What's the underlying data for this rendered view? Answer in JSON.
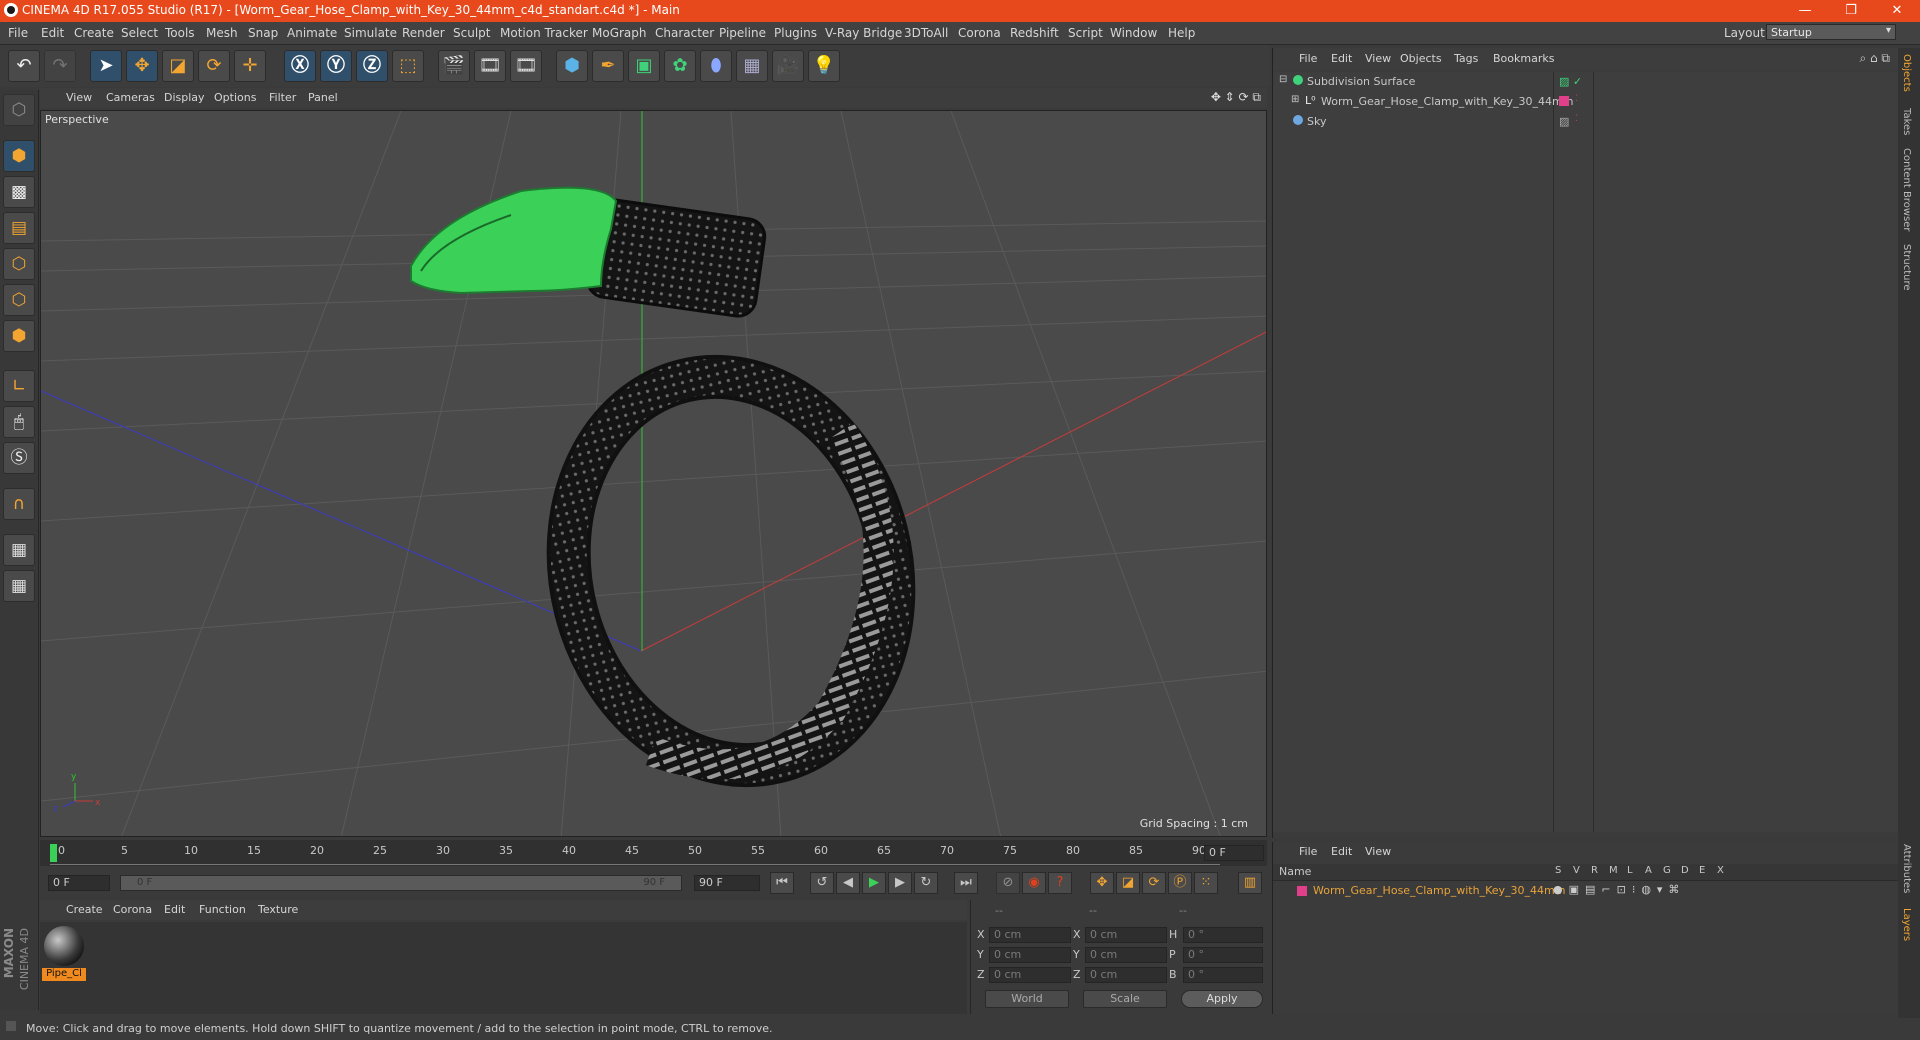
{
  "window": {
    "title": "CINEMA 4D R17.055 Studio (R17) - [Worm_Gear_Hose_Clamp_with_Key_30_44mm_c4d_standart.c4d *] - Main",
    "minimize": "—",
    "maximize": "❐",
    "close": "✕"
  },
  "menubar": [
    "File",
    "Edit",
    "Create",
    "Select",
    "Tools",
    "Mesh",
    "Snap",
    "Animate",
    "Simulate",
    "Render",
    "Sculpt",
    "Motion Tracker",
    "MoGraph",
    "Character",
    "Pipeline",
    "Plugins",
    "V-Ray Bridge",
    "3DToAll",
    "Corona",
    "Redshift",
    "Script",
    "Window",
    "Help"
  ],
  "layout": {
    "label": "Layout:",
    "value": "Startup"
  },
  "viewport": {
    "menu": [
      "View",
      "Cameras",
      "Display",
      "Options",
      "Filter",
      "Panel"
    ],
    "label": "Perspective",
    "grid_spacing": "Grid Spacing : 1 cm"
  },
  "timeline": {
    "ticks": [
      "0",
      "5",
      "10",
      "15",
      "20",
      "25",
      "30",
      "35",
      "40",
      "45",
      "50",
      "55",
      "60",
      "65",
      "70",
      "75",
      "80",
      "85",
      "90"
    ],
    "current_frame": "0 F",
    "start_field": "0 F",
    "range_start": "0 F",
    "range_end": "90 F",
    "end_field": "90 F"
  },
  "material_manager": {
    "menu": [
      "Create",
      "Corona",
      "Edit",
      "Function",
      "Texture"
    ],
    "materials": [
      {
        "name": "Pipe_Cl"
      }
    ]
  },
  "coordinates": {
    "headers": [
      "--",
      "--",
      "--"
    ],
    "rows": [
      {
        "a": "X",
        "av": "0 cm",
        "b": "X",
        "bv": "0 cm",
        "c": "H",
        "cv": "0 °"
      },
      {
        "a": "Y",
        "av": "0 cm",
        "b": "Y",
        "bv": "0 cm",
        "c": "P",
        "cv": "0 °"
      },
      {
        "a": "Z",
        "av": "0 cm",
        "b": "Z",
        "bv": "0 cm",
        "c": "B",
        "cv": "0 °"
      }
    ],
    "space": "World",
    "mode": "Scale",
    "apply": "Apply"
  },
  "status": "Move: Click and drag to move elements. Hold down SHIFT to quantize movement / add to the selection in point mode, CTRL to remove.",
  "object_manager": {
    "menu": [
      "File",
      "Edit",
      "View",
      "Objects",
      "Tags",
      "Bookmarks"
    ],
    "objects": [
      {
        "name": "Subdivision Surface",
        "color": "#c8c8c8"
      },
      {
        "name": "Worm_Gear_Hose_Clamp_with_Key_30_44mm",
        "color": "#c8c8c8"
      },
      {
        "name": "Sky",
        "color": "#c8c8c8"
      }
    ]
  },
  "layer_manager": {
    "menu": [
      "File",
      "Edit",
      "View"
    ],
    "header_name": "Name",
    "header_cols": [
      "S",
      "V",
      "R",
      "M",
      "L",
      "A",
      "G",
      "D",
      "E",
      "X"
    ],
    "layers": [
      {
        "name": "Worm_Gear_Hose_Clamp_with_Key_30_44mm",
        "color": "#e8a33a"
      }
    ]
  },
  "side_tabs": [
    "Objects",
    "Takes",
    "Content Browser",
    "Structure",
    "Attributes",
    "Layers"
  ],
  "brand": [
    "MAXON",
    "CINEMA 4D"
  ],
  "colors": {
    "titlebar": "#e8491c",
    "accent": "#f08a1e",
    "model_green": "#3bd158",
    "layer_pink": "#e0408a"
  }
}
